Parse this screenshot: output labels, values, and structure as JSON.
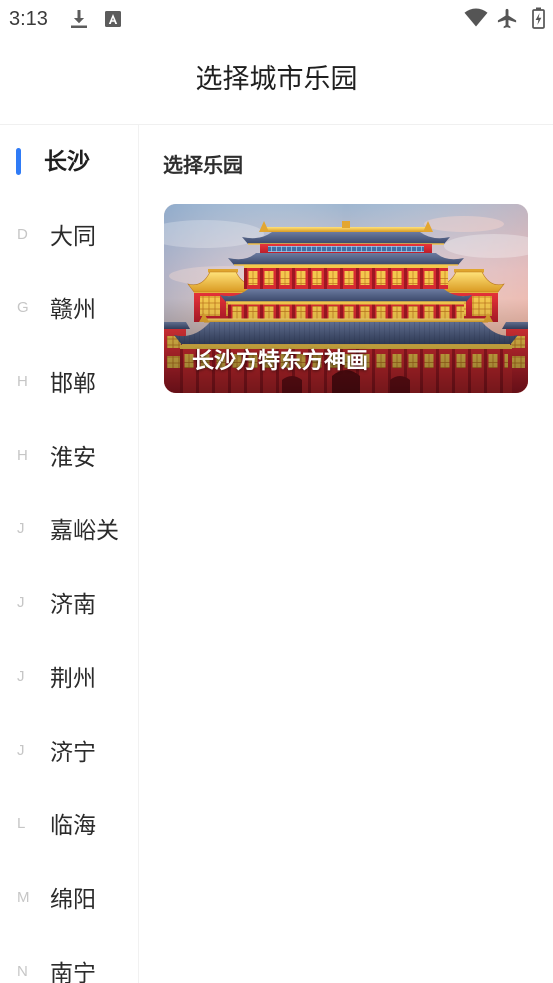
{
  "status_bar": {
    "time": "3:13",
    "icons": {
      "left": [
        "download-icon",
        "font-a-icon"
      ],
      "right": [
        "wifi-icon",
        "airplane-mode-icon",
        "battery-charging-icon"
      ]
    }
  },
  "header": {
    "title": "选择城市乐园"
  },
  "sidebar": {
    "items": [
      {
        "label": "长沙",
        "selected": true
      },
      {
        "letter": "D",
        "label": "大同",
        "selected": false
      },
      {
        "letter": "G",
        "label": "赣州",
        "selected": false
      },
      {
        "letter": "H",
        "label": "邯郸",
        "selected": false
      },
      {
        "letter": "H",
        "label": "淮安",
        "selected": false
      },
      {
        "letter": "J",
        "label": "嘉峪关",
        "selected": false
      },
      {
        "letter": "J",
        "label": "济南",
        "selected": false
      },
      {
        "letter": "J",
        "label": "荆州",
        "selected": false
      },
      {
        "letter": "J",
        "label": "济宁",
        "selected": false
      },
      {
        "letter": "L",
        "label": "临海",
        "selected": false
      },
      {
        "letter": "M",
        "label": "绵阳",
        "selected": false
      },
      {
        "letter": "N",
        "label": "南宁",
        "selected": false
      }
    ]
  },
  "main": {
    "section_title": "选择乐园",
    "parks": [
      {
        "name": "长沙方特东方神画"
      }
    ]
  },
  "colors": {
    "accent": "#2f7bf6",
    "text_primary": "#1f1f1f",
    "text_secondary": "#2b2b2b",
    "index_letter": "#c6c6c6",
    "divider": "#f1f1f1",
    "card_caption": "#ffffff"
  }
}
